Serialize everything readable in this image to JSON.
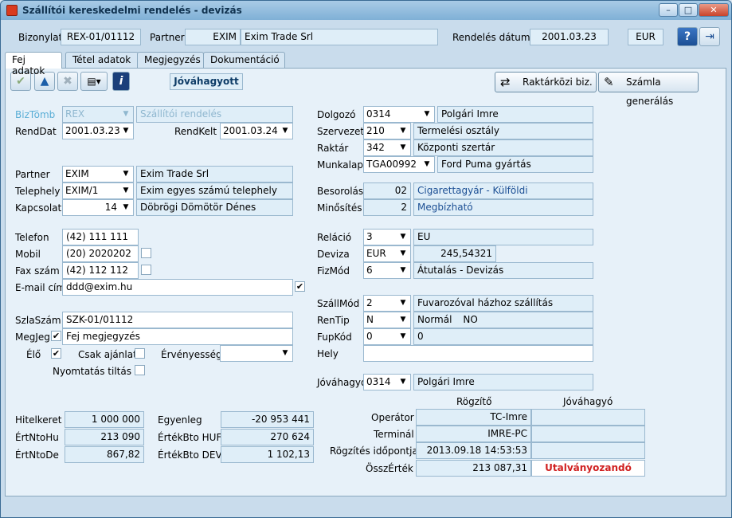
{
  "window": {
    "title": "Szállítói kereskedelmi rendelés - devizás",
    "min": "–",
    "max": "□",
    "close": "✕"
  },
  "header": {
    "bizonylat_label": "Bizonylat",
    "bizonylat_value": "REX-01/01112",
    "partner_label": "Partner",
    "partner_code": "EXIM",
    "partner_name": "Exim Trade Srl",
    "date_label": "Rendelés dátuma",
    "date_value": "2001.03.23",
    "currency": "EUR",
    "help_icon": "?",
    "exit_icon": "⇥"
  },
  "tabs": [
    "Fej adatok",
    "Tétel adatok",
    "Megjegyzés",
    "Dokumentáció"
  ],
  "toolbar": {
    "check_icon": "✔",
    "up_icon": "▲",
    "delete_icon": "✖",
    "print_icon": "▤▾",
    "info_icon": "i",
    "status": "Jóváhagyott",
    "transfer_button": "Raktárközi biz.",
    "invoice_button": "Számla generálás"
  },
  "left": {
    "biztomb_label": "BizTömb",
    "biztomb_value": "REX",
    "biztomb_name": "Szállítói rendelés",
    "renddat_label": "RendDat",
    "renddat_value": "2001.03.23",
    "rendkelt_label": "RendKelt",
    "rendkelt_value": "2001.03.24",
    "partner_label": "Partner",
    "partner_value": "EXIM",
    "partner_name": "Exim Trade Srl",
    "telephely_label": "Telephely",
    "telephely_value": "EXIM/1",
    "telephely_name": "Exim egyes számú telephely",
    "kapcsolat_label": "Kapcsolat",
    "kapcsolat_value": "14",
    "kapcsolat_name": "Döbrögi Dömötör Dénes",
    "telefon_label": "Telefon",
    "telefon_value": "(42) 111 111",
    "mobil_label": "Mobil",
    "mobil_value": "(20) 2020202",
    "fax_label": "Fax szám",
    "fax_value": "(42) 112 112",
    "email_label": "E-mail cím",
    "email_value": "ddd@exim.hu",
    "szlaszam_label": "SzlaSzám",
    "szlaszam_value": "SZK-01/01112",
    "megjeg_label": "MegJeg",
    "megjeg_value": "Fej megjegyzés",
    "elo_label": "Élő",
    "csak_label": "Csak ajánlat",
    "ervenyesseg_label": "Érvényesség",
    "nyomtatas_label": "Nyomtatás tiltás"
  },
  "right": {
    "dolgozo_label": "Dolgozó",
    "dolgozo_value": "0314",
    "dolgozo_name": "Polgári Imre",
    "szervezet_label": "Szervezet",
    "szervezet_value": "210",
    "szervezet_name": "Termelési osztály",
    "raktar_label": "Raktár",
    "raktar_value": "342",
    "raktar_name": "Központi szertár",
    "munkalap_label": "Munkalap",
    "munkalap_value": "TGA00992",
    "munkalap_name": "Ford Puma gyártás",
    "besorolas_label": "Besorolás",
    "besorolas_value": "02",
    "besorolas_name": "Cigarettagyár - Külföldi",
    "minosites_label": "Minősítés",
    "minosites_value": "2",
    "minosites_name": "Megbízható",
    "relacio_label": "Reláció",
    "relacio_value": "3",
    "relacio_name": "EU",
    "deviza_label": "Deviza",
    "deviza_value": "EUR",
    "deviza_rate": "245,54321",
    "fizmod_label": "FizMód",
    "fizmod_value": "6",
    "fizmod_name": "Átutalás - Devizás",
    "szallmod_label": "SzállMód",
    "szallmod_value": "2",
    "szallmod_name": "Fuvarozóval házhoz szállítás",
    "rentip_label": "RenTip",
    "rentip_value": "N",
    "rentip_name": "Normál",
    "rentip_extra": "NO",
    "fupkod_label": "FupKód",
    "fupkod_value": "0",
    "fupkod_name": "0",
    "hely_label": "Hely",
    "jovahagyo_label": "Jóváhagyó",
    "jovahagyo_value": "0314",
    "jovahagyo_name": "Polgári Imre"
  },
  "totals": {
    "hitelkeret_label": "Hitelkeret",
    "hitelkeret_value": "1 000 000",
    "ertntohu_label": "ÉrtNtoHu",
    "ertntohu_value": "213 090",
    "ertntode_label": "ÉrtNtoDe",
    "ertntode_value": "867,82",
    "egyenleg_label": "Egyenleg",
    "egyenleg_value": "-20 953 441",
    "ertbtohuf_label": "ÉrtékBto HUF",
    "ertbtohuf_value": "270 624",
    "ertbtodev_label": "ÉrtékBto DEV",
    "ertbtodev_value": "1 102,13"
  },
  "audit": {
    "col_rogzito": "Rögzítő",
    "col_jovahagyo": "Jóváhagyó",
    "operator_label": "Operátor",
    "operator_value": "TC-Imre",
    "terminal_label": "Terminál",
    "terminal_value": "IMRE-PC",
    "rogzites_label": "Rögzítés időpontja",
    "rogzites_value": "2013.09.18 14:53:53",
    "osszertek_label": "ÖsszÉrték",
    "osszertek_value": "213 087,31",
    "osszertek_status": "Utalványozandó"
  }
}
